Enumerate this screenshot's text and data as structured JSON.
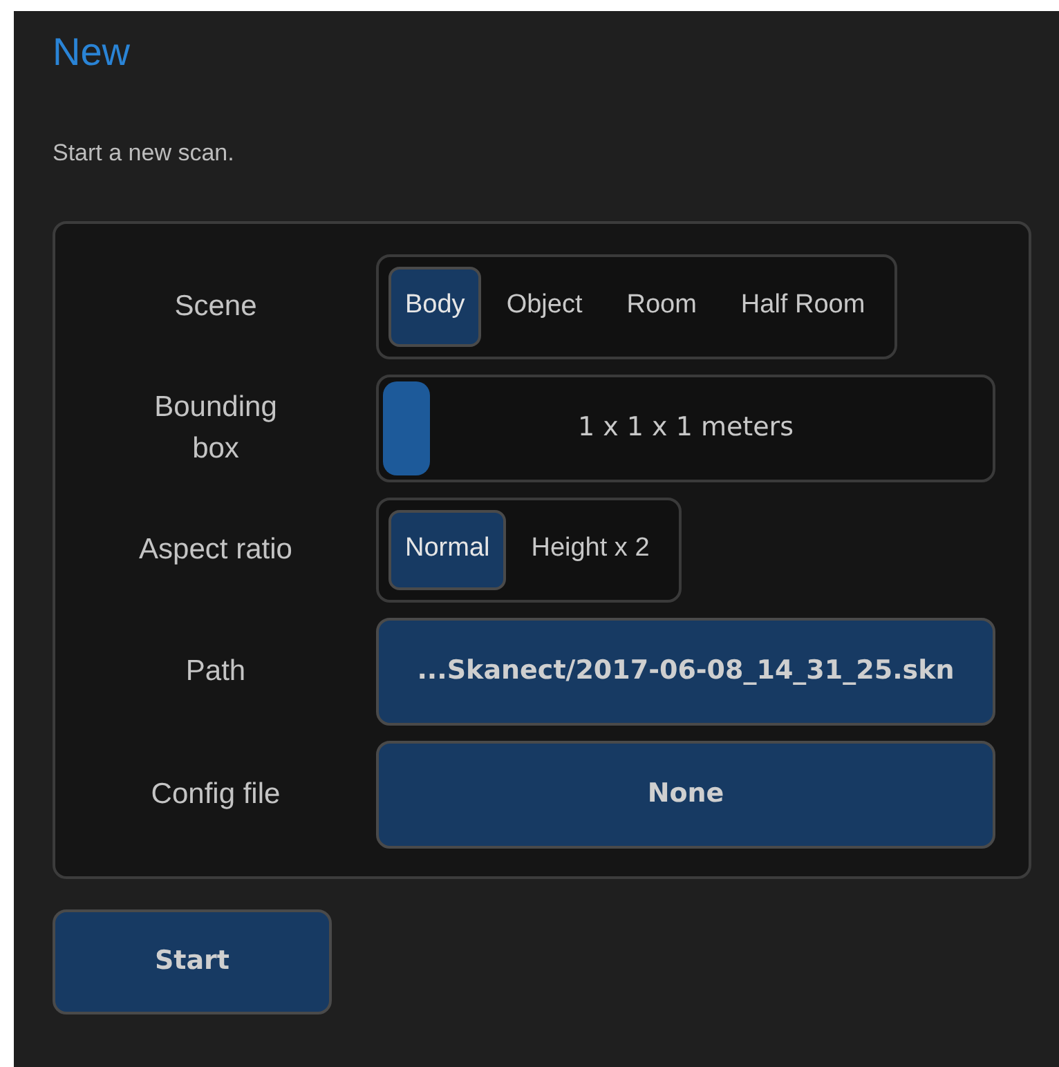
{
  "title": "New",
  "description": "Start a new scan.",
  "fields": [
    {
      "kind": "segmented",
      "label": "Scene",
      "options": [
        {
          "label": "Body",
          "selected": true
        },
        {
          "label": "Object",
          "selected": false
        },
        {
          "label": "Room",
          "selected": false
        },
        {
          "label": "Half Room",
          "selected": false
        }
      ]
    },
    {
      "kind": "slider",
      "label": "Bounding box",
      "level": 0,
      "reading": "1 x 1 x 1 meters"
    },
    {
      "kind": "segmented",
      "label": "Aspect ratio",
      "options": [
        {
          "label": "Normal",
          "selected": true
        },
        {
          "label": "Height x 2",
          "selected": false
        }
      ]
    },
    {
      "kind": "button",
      "label": "Path",
      "value": "...Skanect/2017-06-08_14_31_25.skn"
    },
    {
      "kind": "button",
      "label": "Config file",
      "value": "None"
    }
  ],
  "start_button": "Start"
}
